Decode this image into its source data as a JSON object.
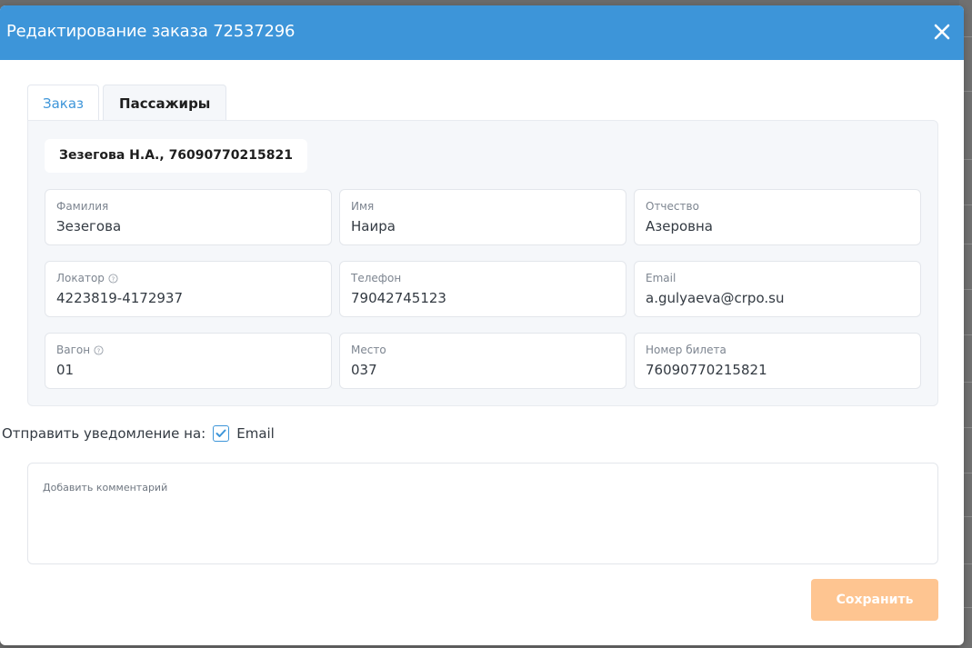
{
  "modal": {
    "title": "Редактирование заказа 72537296"
  },
  "tabs": [
    {
      "label": "Заказ"
    },
    {
      "label": "Пассажиры"
    }
  ],
  "passenger_chip": "Зезегова Н.А., 76090770215821",
  "fields": {
    "last_name": {
      "label": "Фамилия",
      "value": "Зезегова"
    },
    "first_name": {
      "label": "Имя",
      "value": "Наира"
    },
    "middle_name": {
      "label": "Отчество",
      "value": "Азеровна"
    },
    "locator": {
      "label": "Локатор",
      "value": "4223819-4172937"
    },
    "phone": {
      "label": "Телефон",
      "value": "79042745123"
    },
    "email": {
      "label": "Email",
      "value": "a.gulyaeva@crpo.su"
    },
    "car": {
      "label": "Вагон",
      "value": "01"
    },
    "seat": {
      "label": "Место",
      "value": "037"
    },
    "ticket": {
      "label": "Номер билета",
      "value": "76090770215821"
    }
  },
  "notify": {
    "label": "Отправить уведомление на:",
    "checkbox_label": "Email",
    "checked": true
  },
  "comment": {
    "placeholder": "Добавить комментарий"
  },
  "save_button": "Сохранить",
  "colors": {
    "header": "#3d95d9",
    "accent": "#3d95d9",
    "save_button": "#fec591",
    "panel": "#f5f7fa"
  },
  "icons": {
    "close": "close-icon",
    "help": "help-icon",
    "check": "checkmark-icon"
  }
}
